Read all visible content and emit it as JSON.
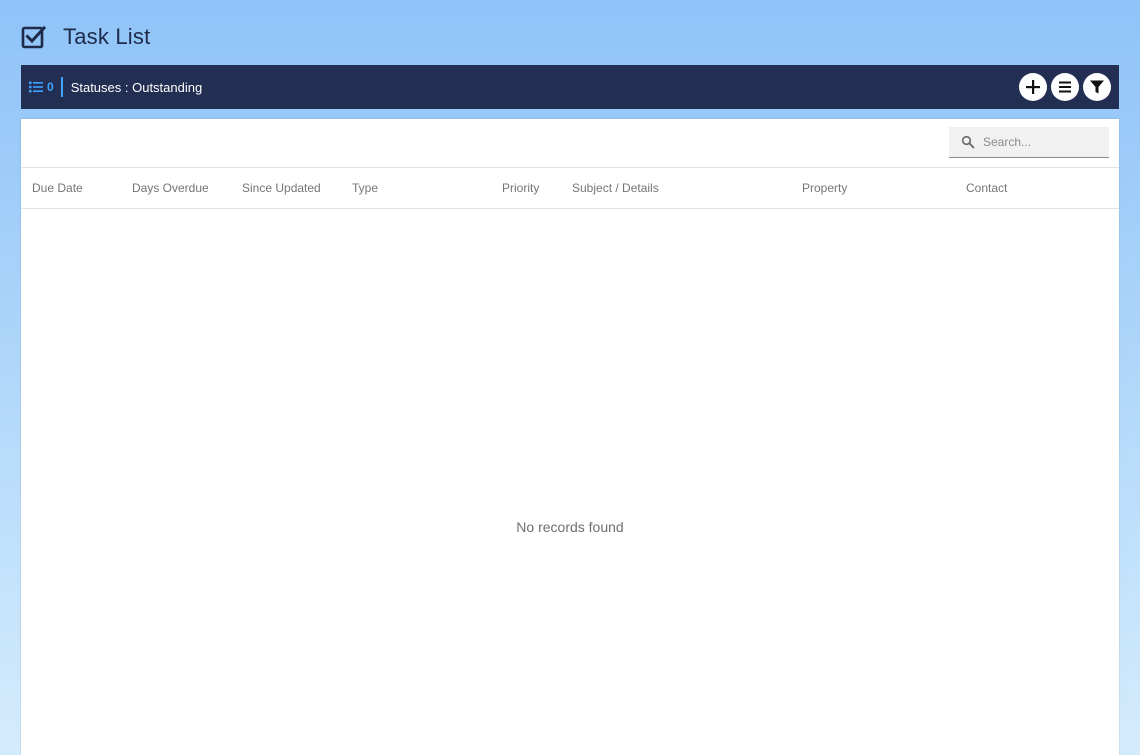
{
  "header": {
    "title": "Task List",
    "icon": "checkbox-checked-icon"
  },
  "toolbar": {
    "count": "0",
    "status_filter": "Statuses : Outstanding",
    "actions": [
      "add-icon",
      "menu-icon",
      "filter-icon"
    ]
  },
  "search": {
    "placeholder": "Search...",
    "value": ""
  },
  "table": {
    "columns": [
      "Due Date",
      "Days Overdue",
      "Since Updated",
      "Type",
      "Priority",
      "Subject / Details",
      "Property",
      "Contact"
    ],
    "rows": [],
    "empty_message": "No records found"
  },
  "colors": {
    "toolbar_bg": "#222e52",
    "accent": "#3fa3ff",
    "title": "#1e2a4a"
  }
}
